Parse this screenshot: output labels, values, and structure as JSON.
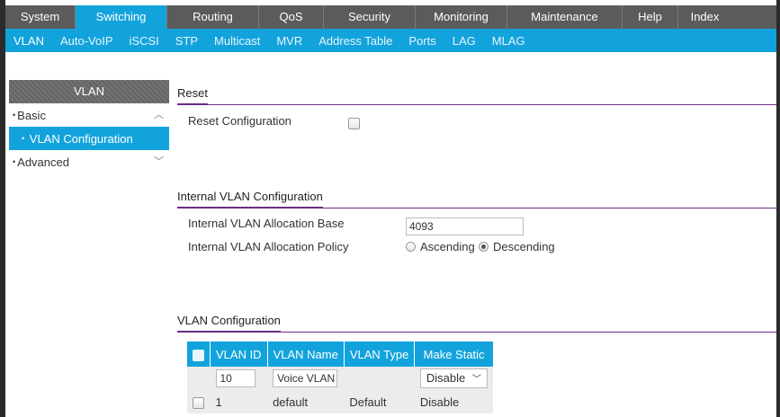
{
  "top_tabs": [
    {
      "label": "System",
      "width": 78
    },
    {
      "label": "Switching",
      "width": 102,
      "active": true
    },
    {
      "label": "Routing",
      "width": 102
    },
    {
      "label": "QoS",
      "width": 72
    },
    {
      "label": "Security",
      "width": 102
    },
    {
      "label": "Monitoring",
      "width": 102
    },
    {
      "label": "Maintenance",
      "width": 128
    },
    {
      "label": "Help",
      "width": 62
    },
    {
      "label": "Index",
      "width": 59
    }
  ],
  "sub_tabs": [
    "VLAN",
    "Auto-VoIP",
    "iSCSI",
    "STP",
    "Multicast",
    "MVR",
    "Address Table",
    "Ports",
    "LAG",
    "MLAG"
  ],
  "sidebar": {
    "header": "VLAN",
    "basic": "Basic",
    "vlan_config": "VLAN Configuration",
    "advanced": "Advanced"
  },
  "reset": {
    "title": "Reset",
    "label": "Reset Configuration"
  },
  "internal": {
    "title": "Internal VLAN Configuration",
    "base_label": "Internal VLAN Allocation Base",
    "base_value": "4093",
    "policy_label": "Internal VLAN Allocation Policy",
    "ascending": "Ascending",
    "descending": "Descending",
    "selected": "Descending"
  },
  "vlan_config": {
    "title": "VLAN Configuration",
    "headers": [
      "VLAN ID",
      "VLAN Name",
      "VLAN Type",
      "Make Static"
    ],
    "input_row": {
      "id": "10",
      "name": "Voice VLAN",
      "type": "",
      "static": "Disable"
    },
    "rows": [
      {
        "id": "1",
        "name": "default",
        "type": "Default",
        "static": "Disable"
      }
    ]
  }
}
